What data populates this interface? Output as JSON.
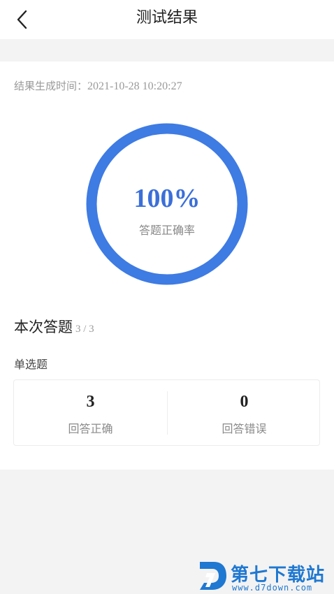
{
  "header": {
    "title": "测试结果",
    "back_icon": "chevron-left-icon"
  },
  "result": {
    "generated_label": "结果生成时间：",
    "generated_time": "2021-10-28 10:20:27",
    "accuracy_text": "100%",
    "accuracy_fraction": 1.0,
    "accuracy_label": "答题正确率",
    "ring_color": "#3e7be3"
  },
  "summary": {
    "title": "本次答题",
    "count": "3 / 3",
    "question_type": "单选题",
    "correct_value": "3",
    "correct_label": "回答正确",
    "wrong_value": "0",
    "wrong_label": "回答错误"
  },
  "watermark": {
    "name": "第七下载站",
    "url": "www.d7down.com",
    "color": "#1f78d1"
  }
}
